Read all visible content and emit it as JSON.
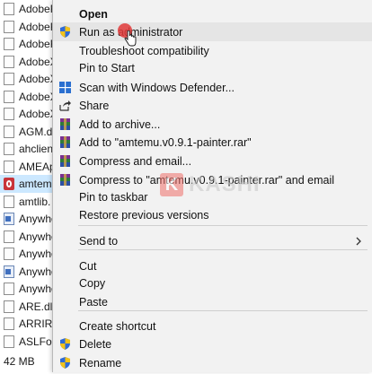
{
  "files": [
    {
      "name": "AdobeF",
      "icon": "file-icon"
    },
    {
      "name": "AdobeF",
      "icon": "file-icon"
    },
    {
      "name": "AdobeF",
      "icon": "file-icon"
    },
    {
      "name": "AdobeX",
      "icon": "file-icon"
    },
    {
      "name": "AdobeX",
      "icon": "file-icon"
    },
    {
      "name": "AdobeX",
      "icon": "file-icon"
    },
    {
      "name": "AdobeX",
      "icon": "file-icon"
    },
    {
      "name": "AGM.dll",
      "icon": "file-icon"
    },
    {
      "name": "ahclient",
      "icon": "file-icon"
    },
    {
      "name": "AMEAp",
      "icon": "file-icon"
    },
    {
      "name": "amtem",
      "icon": "amtemu-icon",
      "selected": true
    },
    {
      "name": "amtlib.",
      "icon": "file-icon"
    },
    {
      "name": "Anywho",
      "icon": "exe-icon"
    },
    {
      "name": "Anywhe",
      "icon": "file-icon"
    },
    {
      "name": "Anywhe",
      "icon": "file-icon"
    },
    {
      "name": "Anywho",
      "icon": "exe-icon"
    },
    {
      "name": "Anywho",
      "icon": "file-icon"
    },
    {
      "name": "ARE.dll",
      "icon": "file-icon"
    },
    {
      "name": "ARRIRA",
      "icon": "file-icon"
    },
    {
      "name": "ASLFou",
      "icon": "file-icon"
    }
  ],
  "status_bar": {
    "size": "42 MB"
  },
  "context_menu": {
    "items": [
      {
        "label": "Open",
        "bold": true,
        "icon": ""
      },
      {
        "label": "Run as administrator",
        "icon": "shield-icon",
        "hover": true
      },
      {
        "label": "Troubleshoot compatibility",
        "icon": ""
      },
      {
        "label": "Pin to Start",
        "icon": ""
      },
      {
        "label": "Scan with Windows Defender...",
        "icon": "defender-icon"
      },
      {
        "label": "Share",
        "icon": "share-icon"
      },
      {
        "label": "Add to archive...",
        "icon": "winrar-icon"
      },
      {
        "label": "Add to \"amtemu.v0.9.1-painter.rar\"",
        "icon": "winrar-icon"
      },
      {
        "label": "Compress and email...",
        "icon": "winrar-icon"
      },
      {
        "label": "Compress to \"amtemu.v0.9.1-painter.rar\" and email",
        "icon": "winrar-icon"
      },
      {
        "label": "Pin to taskbar",
        "icon": ""
      },
      {
        "label": "Restore previous versions",
        "icon": ""
      },
      {
        "label": "Send to",
        "icon": "",
        "submenu": true
      },
      {
        "label": "Cut",
        "icon": ""
      },
      {
        "label": "Copy",
        "icon": ""
      },
      {
        "label": "Paste",
        "icon": ""
      },
      {
        "label": "Create shortcut",
        "icon": ""
      },
      {
        "label": "Delete",
        "icon": "shield-icon"
      },
      {
        "label": "Rename",
        "icon": "shield-icon"
      }
    ]
  },
  "watermark": {
    "badge": "K",
    "text": "KASHI"
  },
  "colors": {
    "menu_bg": "#f2f2f2",
    "hover_bg": "#e5e5e5",
    "selected_row": "#cce8ff",
    "click_marker": "#e23b3b"
  }
}
